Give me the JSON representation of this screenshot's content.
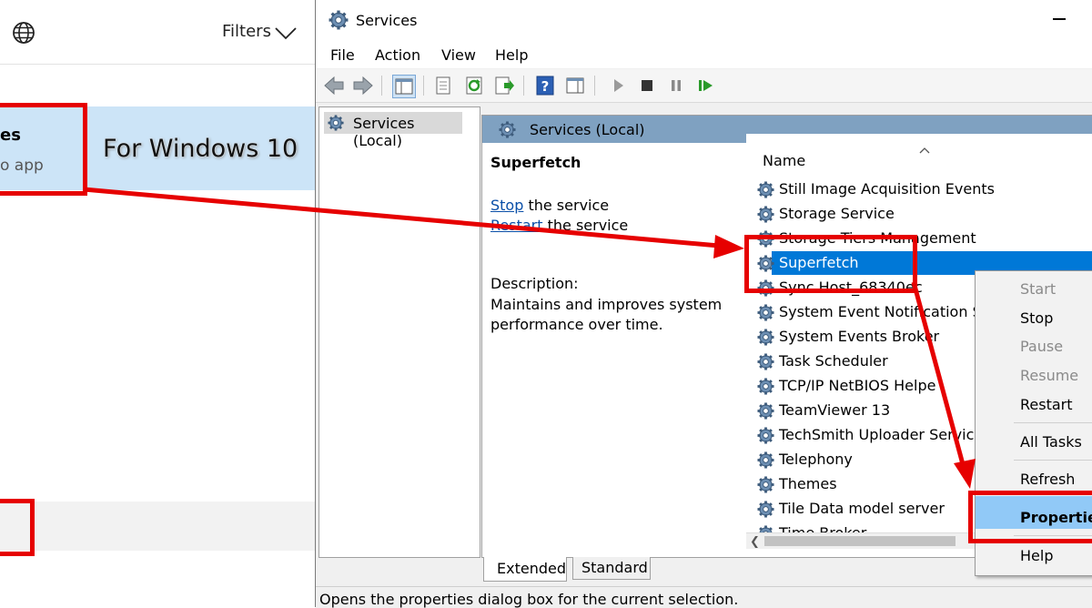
{
  "left_panel": {
    "filters_label": "Filters",
    "result_title": "es",
    "result_sub": "o app",
    "note": "For Windows 10"
  },
  "window": {
    "title": "Services",
    "menu": [
      "File",
      "Action",
      "View",
      "Help"
    ],
    "tree_item": "Services (Local)",
    "content_header": "Services (Local)",
    "selected_service": "Superfetch",
    "stop_link": "Stop",
    "stop_rest": " the service",
    "restart_link": "Restart",
    "restart_rest": " the service",
    "description_label": "Description:",
    "description": "Maintains and improves system performance over time.",
    "column_name": "Name",
    "services": [
      "Still Image Acquisition Events",
      "Storage Service",
      "Storage Tiers Management",
      "Superfetch",
      "Sync Host_68340ec",
      "System Event Notification S",
      "System Events Broker",
      "Task Scheduler",
      "TCP/IP NetBIOS Helpe",
      "TeamViewer 13",
      "TechSmith Uploader Servic",
      "Telephony",
      "Themes",
      "Tile Data model server",
      "Time Broker"
    ],
    "tabs": [
      "Extended",
      "Standard"
    ],
    "status": "Opens the properties dialog box for the current selection."
  },
  "context_menu": {
    "items": [
      {
        "label": "Start",
        "enabled": false
      },
      {
        "label": "Stop",
        "enabled": true
      },
      {
        "label": "Pause",
        "enabled": false
      },
      {
        "label": "Resume",
        "enabled": false
      },
      {
        "label": "Restart",
        "enabled": true
      },
      {
        "label": "All Tasks",
        "enabled": true
      },
      {
        "label": "Refresh",
        "enabled": true
      },
      {
        "label": "Properties",
        "enabled": true,
        "highlighted": true
      },
      {
        "label": "Help",
        "enabled": true
      }
    ]
  },
  "colors": {
    "annotation_red": "#e60000",
    "selection_blue": "#0078d7",
    "header_blue": "#7fa1c1",
    "search_highlight": "#cce4f7",
    "menu_highlight": "#91c9f7"
  }
}
